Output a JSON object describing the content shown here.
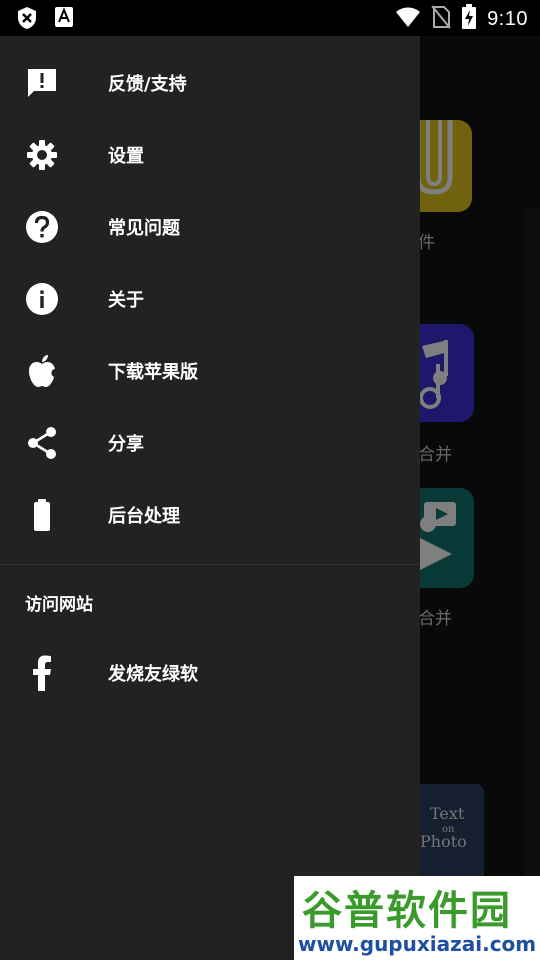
{
  "status_bar": {
    "time": "9:10"
  },
  "drawer": {
    "items": [
      {
        "label": "反馈/支持",
        "icon": "feedback-icon"
      },
      {
        "label": "设置",
        "icon": "gear-icon"
      },
      {
        "label": "常见问题",
        "icon": "help-icon"
      },
      {
        "label": "关于",
        "icon": "info-icon"
      },
      {
        "label": "下载苹果版",
        "icon": "apple-icon"
      },
      {
        "label": "分享",
        "icon": "share-icon"
      },
      {
        "label": "后台处理",
        "icon": "battery-icon"
      }
    ],
    "section_title": "访问网站",
    "links": [
      {
        "label": "发烧友绿软",
        "icon": "facebook-icon"
      }
    ]
  },
  "background": {
    "labels": [
      "件",
      "合并",
      "合并"
    ],
    "tile_text": [
      "Text",
      "on",
      "Photo"
    ]
  },
  "watermark": {
    "title": "谷普软件园",
    "url": "www.gupuxiazai.com"
  },
  "colors": {
    "drawer_bg": "#222222",
    "tile_yellow": "#e0c51d",
    "tile_purple": "#3f2fd8",
    "tile_teal": "#14746f"
  }
}
